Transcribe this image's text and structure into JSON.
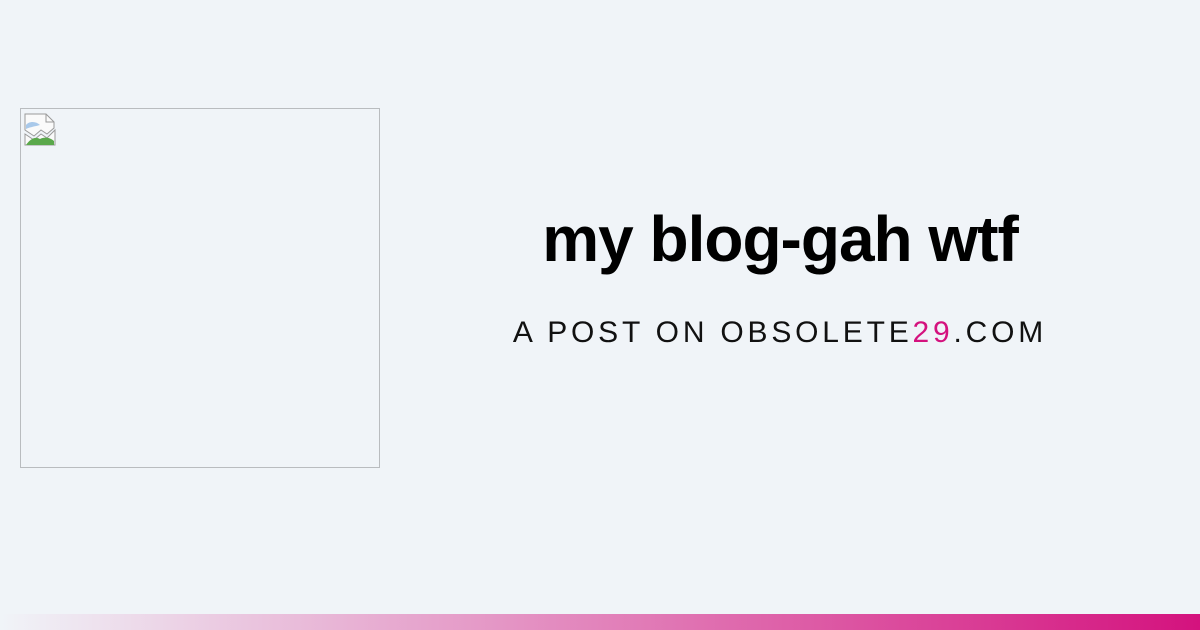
{
  "post": {
    "title": "my blog-gah wtf",
    "subtitle_prefix": "A POST ON OBSOLETE",
    "subtitle_accent": "29",
    "subtitle_suffix": ".COM"
  },
  "colors": {
    "background": "#f0f4f8",
    "accent": "#d4127e",
    "image_border": "#b9bcbf",
    "gradient_start": "#f0f4f8",
    "gradient_end": "#d4127e"
  },
  "image": {
    "icon": "broken-image-icon"
  }
}
